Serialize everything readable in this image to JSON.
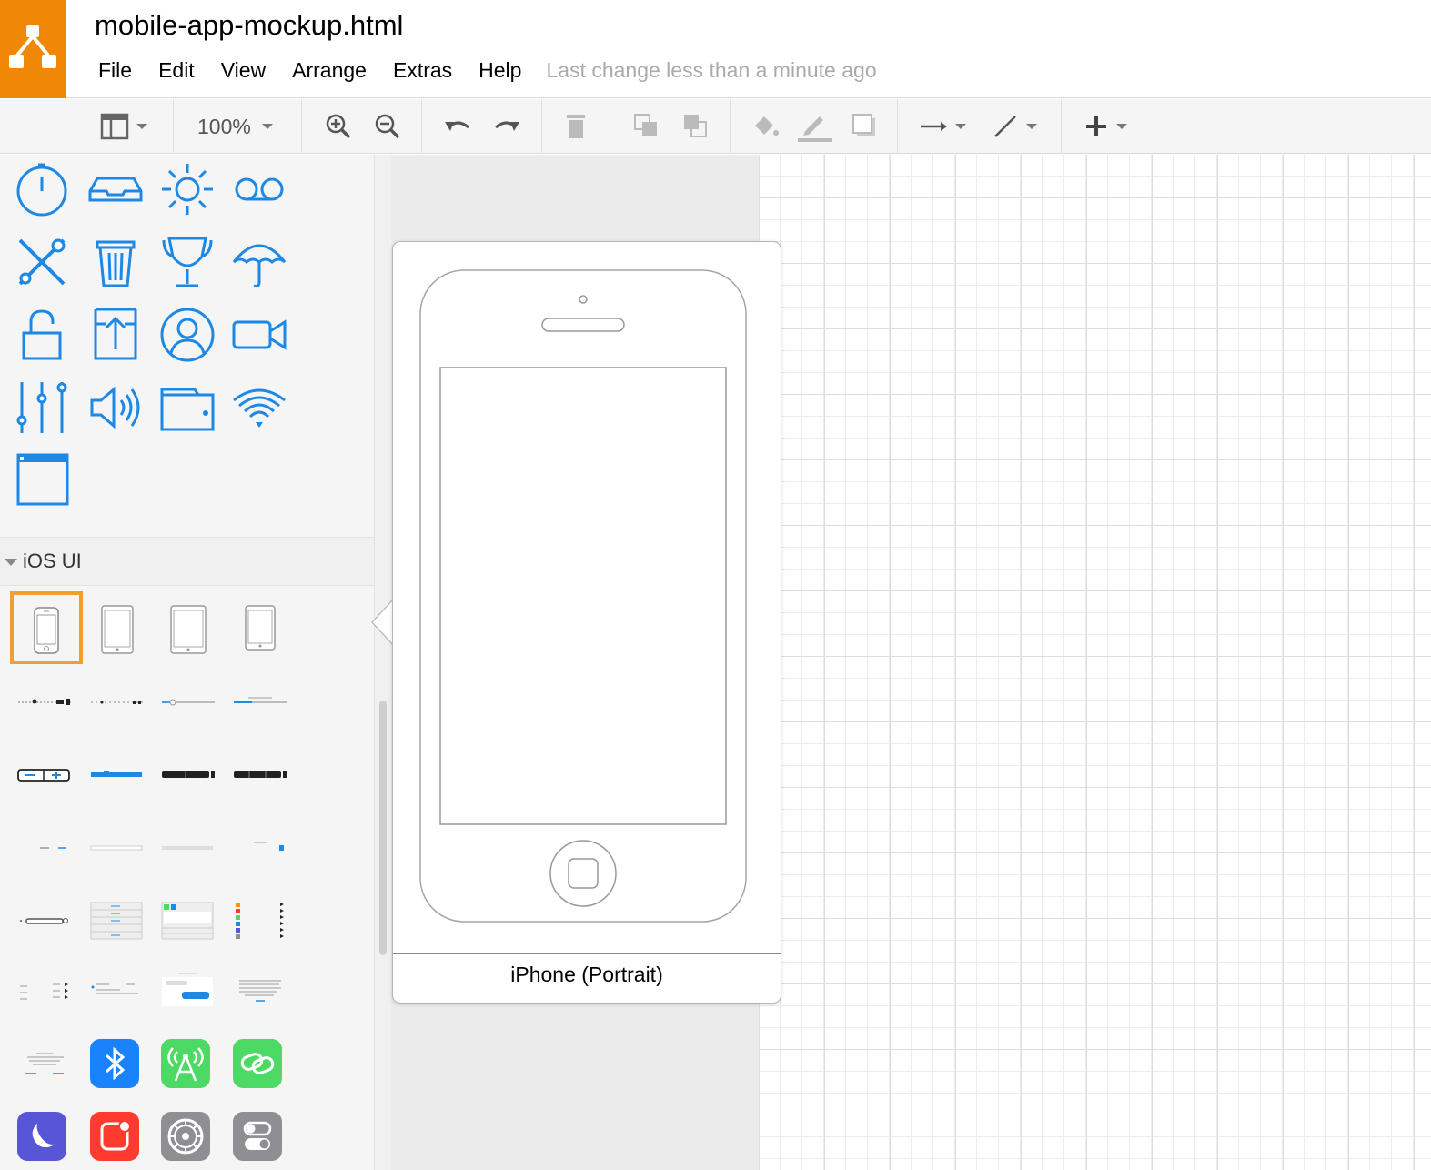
{
  "app": {
    "document_title": "mobile-app-mockup.html",
    "logo_icon": "drawio-logo-icon",
    "brand_color": "#f08705"
  },
  "menubar": {
    "items": [
      "File",
      "Edit",
      "View",
      "Arrange",
      "Extras",
      "Help"
    ],
    "status": "Last change less than a minute ago"
  },
  "toolbar": {
    "zoom": "100%",
    "buttons": [
      "format-panel-icon",
      "zoom-in-icon",
      "zoom-out-icon",
      "undo-icon",
      "redo-icon",
      "delete-icon",
      "to-front-icon",
      "to-back-icon",
      "fill-color-icon",
      "line-color-icon",
      "shadow-icon",
      "connection-icon",
      "waypoints-icon",
      "insert-plus-icon"
    ]
  },
  "sidebar": {
    "icon_color": "#1e88e5",
    "top_icons": [
      "stopwatch-icon",
      "inbox-icon",
      "sun-icon",
      "voicemail-icon",
      "tools-icon",
      "trash-icon",
      "trophy-icon",
      "umbrella-icon",
      "unlock-icon",
      "upload-icon",
      "user-icon",
      "video-icon",
      "sliders-icon",
      "volume-icon",
      "wallet-icon",
      "wifi-icon",
      "window-icon"
    ],
    "section": {
      "label": "iOS UI"
    },
    "ios_thumbnails": [
      "iphone-portrait",
      "ipad-mini",
      "ipad",
      "ipad-landscape",
      "slider-controls",
      "slider-small",
      "slider-thumb",
      "progress-bar",
      "stepper",
      "segmented-control",
      "action-bar-dark",
      "action-bar-paste",
      "labels",
      "text-field",
      "search-bar",
      "button-blue",
      "toggle-bar",
      "table-view",
      "app-screen",
      "colored-list",
      "label-list",
      "notification",
      "message-bubble",
      "dialog-text",
      "alert-dialog"
    ],
    "app_icons": [
      {
        "name": "bluetooth-icon",
        "color": "#1a82fb"
      },
      {
        "name": "cellular-icon",
        "color": "#4cd964"
      },
      {
        "name": "link-icon",
        "color": "#4cd964"
      },
      {
        "name": "moon-icon",
        "color": "#5856d6"
      },
      {
        "name": "notification-icon",
        "color": "#ff3b30"
      },
      {
        "name": "settings-icon",
        "color": "#8e8e93"
      },
      {
        "name": "toggles-icon",
        "color": "#8e8e93"
      }
    ]
  },
  "tooltip": {
    "shape_label": "iPhone (Portrait)"
  }
}
